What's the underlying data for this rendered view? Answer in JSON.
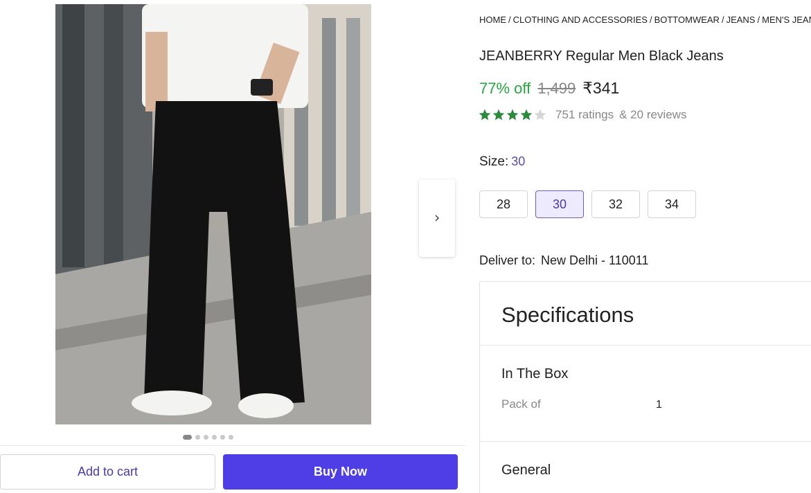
{
  "gallery": {
    "image_alt": "JEANBERRY Regular Men Black Jeans",
    "dots_count": 6,
    "active_dot": 0
  },
  "actions": {
    "add_to_cart": "Add to cart",
    "buy_now": "Buy Now"
  },
  "breadcrumb": [
    "HOME",
    "CLOTHING AND ACCESSORIES",
    "BOTTOMWEAR",
    "JEANS",
    "MEN'S JEANS"
  ],
  "product": {
    "title": "JEANBERRY Regular Men Black Jeans",
    "discount": "77% off",
    "mrp": "1,499",
    "price": "₹341",
    "rating_value": 4,
    "rating_max": 5,
    "ratings": "751 ratings",
    "reviews": "& 20 reviews"
  },
  "size": {
    "label": "Size:",
    "selected": "30",
    "options": [
      "28",
      "30",
      "32",
      "34"
    ]
  },
  "delivery": {
    "label": "Deliver to:",
    "location": "New Delhi - 110011"
  },
  "specifications": {
    "title": "Specifications",
    "in_the_box": "In The Box",
    "pack_of_label": "Pack of",
    "pack_of_value": "1",
    "general": "General"
  },
  "colors": {
    "accent": "#4f3de6",
    "discount_green": "#26a541",
    "star_green": "#2e8b3d",
    "selected_size_bg": "#eeeaff"
  },
  "icons": {
    "next": "chevron-right-icon",
    "star": "star-icon"
  }
}
